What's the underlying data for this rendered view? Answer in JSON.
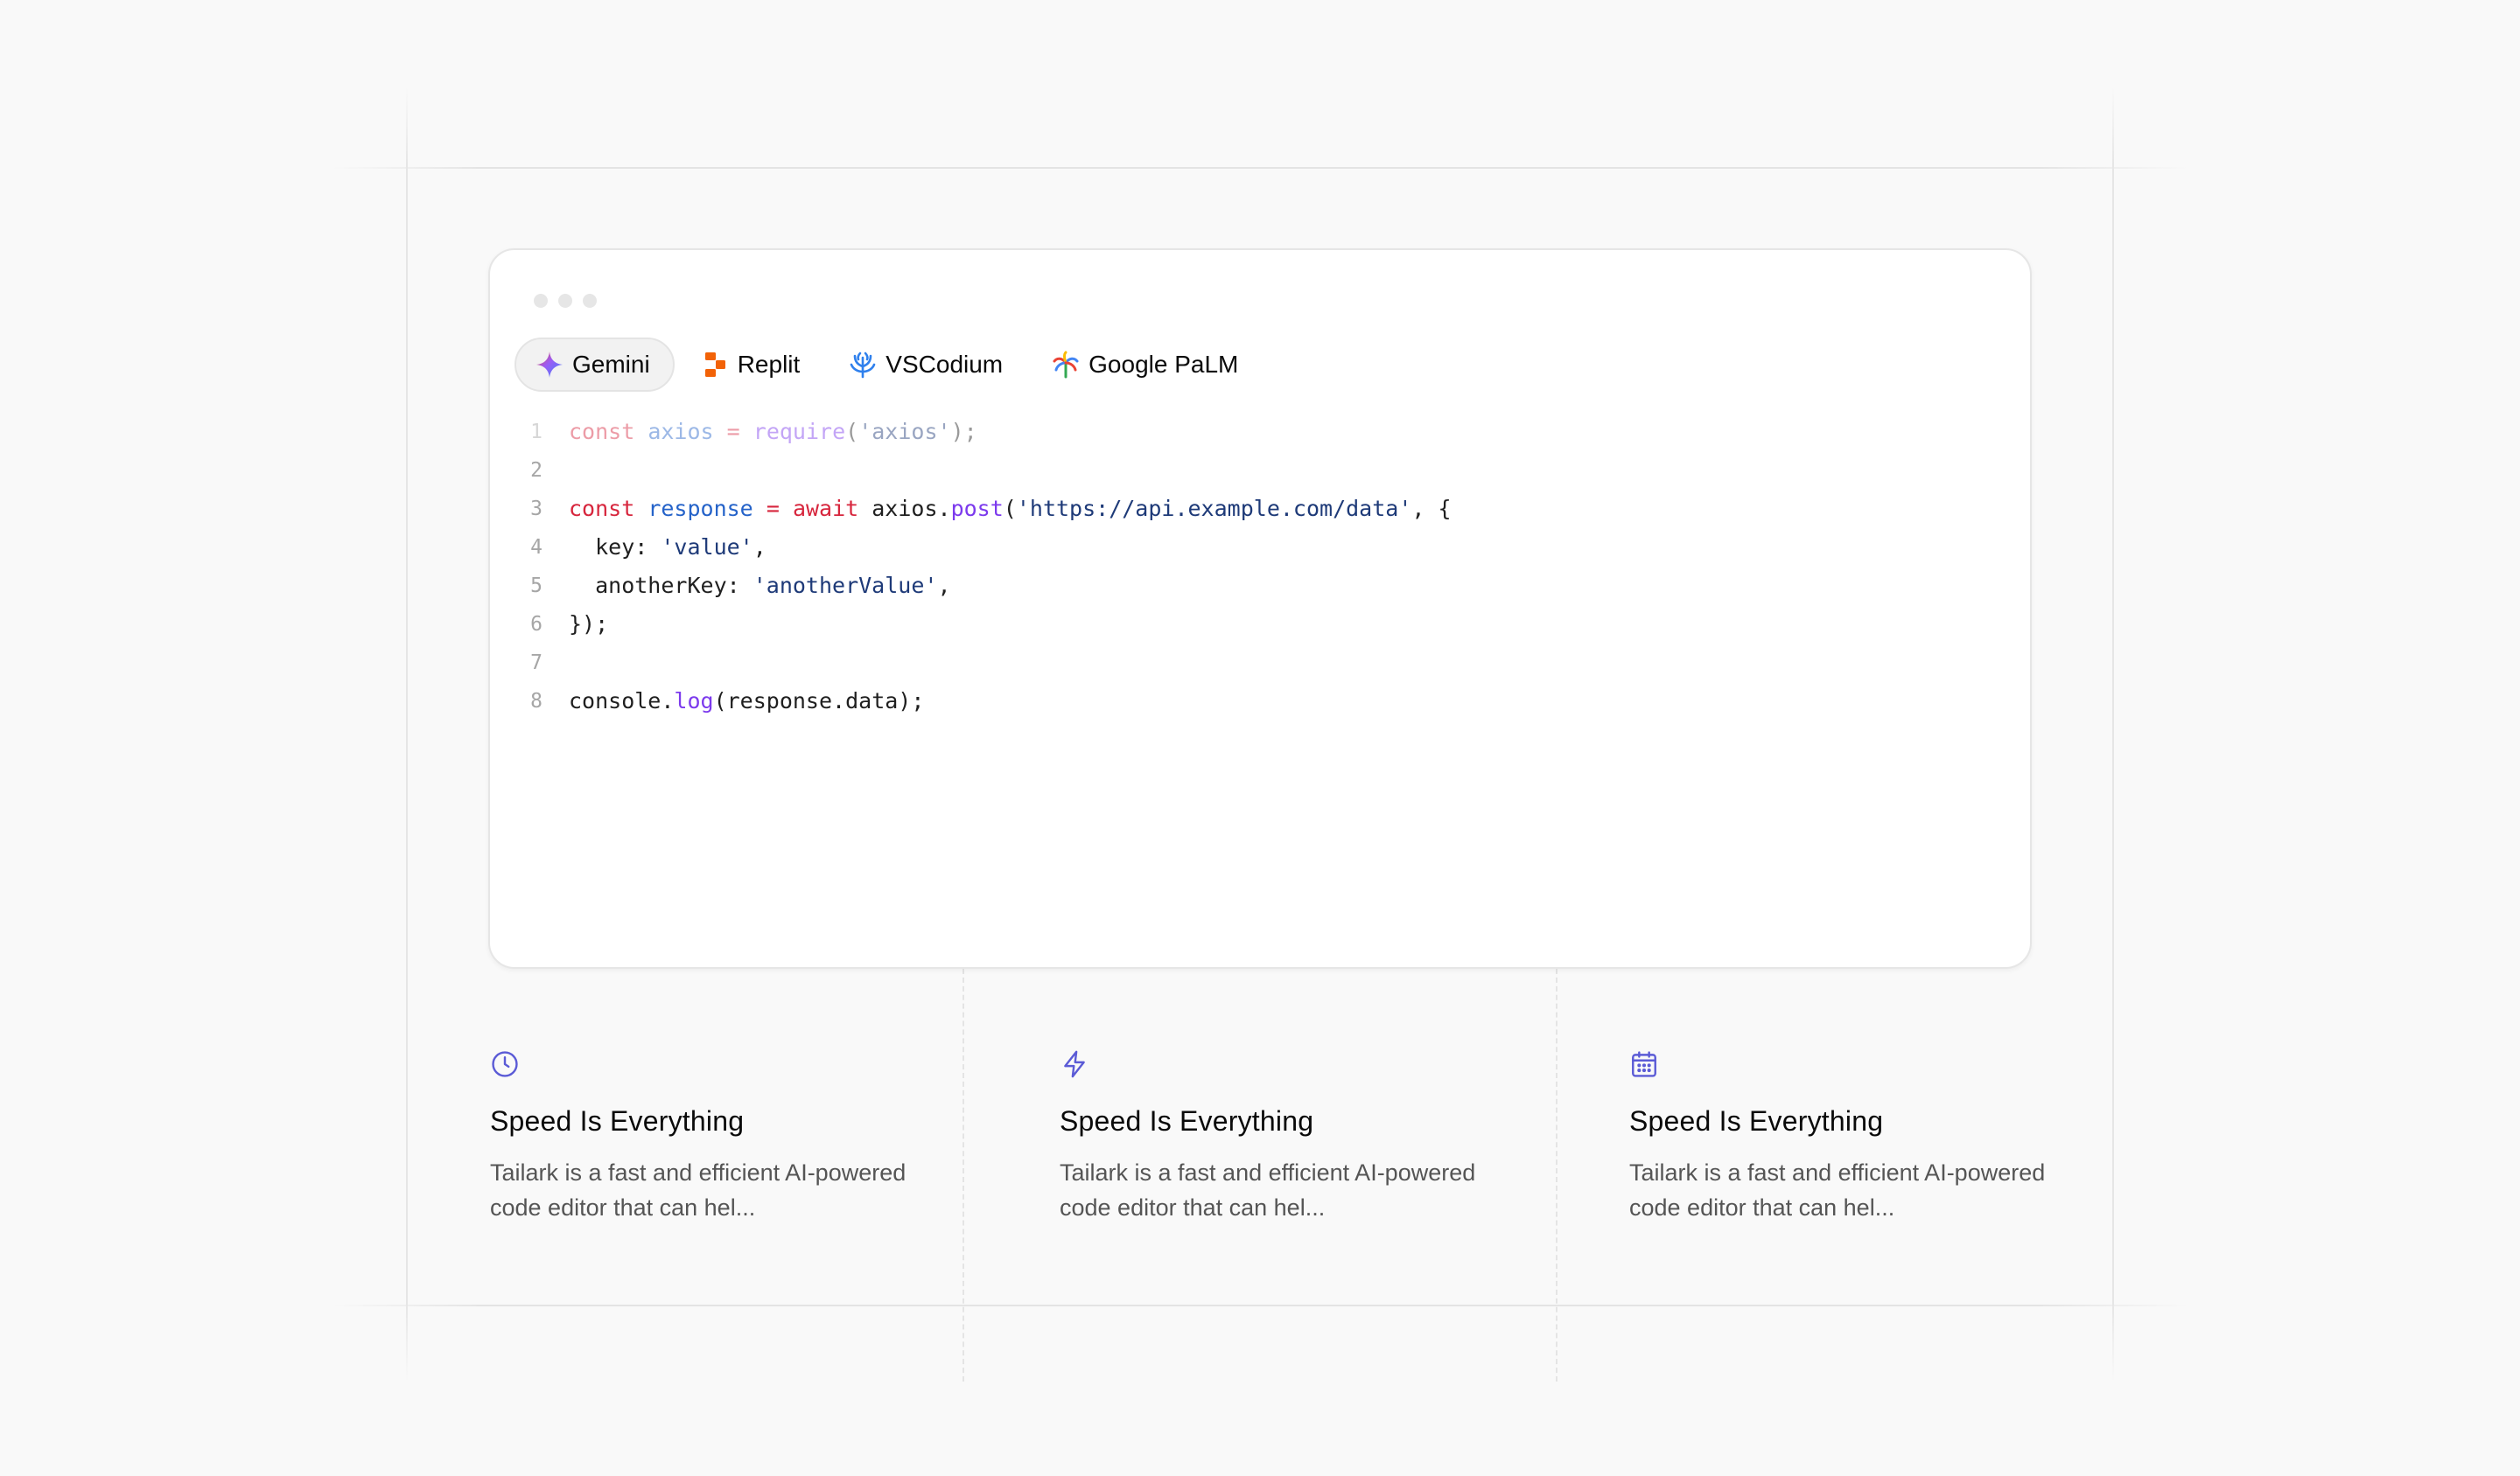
{
  "window": {
    "tabs": [
      {
        "label": "Gemini",
        "icon": "gemini-icon",
        "active": true
      },
      {
        "label": "Replit",
        "icon": "replit-icon",
        "active": false
      },
      {
        "label": "VSCodium",
        "icon": "vscodium-icon",
        "active": false
      },
      {
        "label": "Google PaLM",
        "icon": "google-palm-icon",
        "active": false
      }
    ],
    "code_lines": [
      {
        "number": "1",
        "text": "const axios = require('axios');"
      },
      {
        "number": "2",
        "text": ""
      },
      {
        "number": "3",
        "text": "const response = await axios.post('https://api.example.com/data', {"
      },
      {
        "number": "4",
        "text": "  key: 'value',"
      },
      {
        "number": "5",
        "text": "  anotherKey: 'anotherValue',"
      },
      {
        "number": "6",
        "text": "});"
      },
      {
        "number": "7",
        "text": ""
      },
      {
        "number": "8",
        "text": "console.log(response.data);"
      }
    ]
  },
  "features": [
    {
      "icon": "clock-icon",
      "title": "Speed Is Everything",
      "description": "Tailark is a fast and efficient AI-powered code editor that can hel..."
    },
    {
      "icon": "lightning-icon",
      "title": "Speed Is Everything",
      "description": "Tailark is a fast and efficient AI-powered code editor that can hel..."
    },
    {
      "icon": "calendar-icon",
      "title": "Speed Is Everything",
      "description": "Tailark is a fast and efficient AI-powered code editor that can hel..."
    }
  ],
  "colors": {
    "accent": "#5b5bd6",
    "keyword": "#d7263d",
    "variable": "#2563c9",
    "function": "#7c3aed",
    "string": "#1e3a78"
  }
}
